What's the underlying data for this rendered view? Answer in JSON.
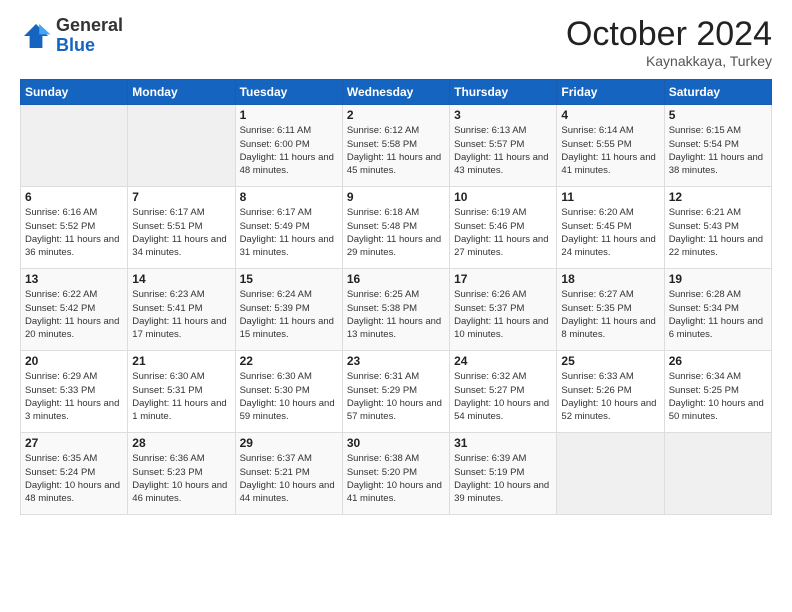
{
  "logo": {
    "general": "General",
    "blue": "Blue"
  },
  "title": "October 2024",
  "location": "Kaynakkaya, Turkey",
  "days_header": [
    "Sunday",
    "Monday",
    "Tuesday",
    "Wednesday",
    "Thursday",
    "Friday",
    "Saturday"
  ],
  "weeks": [
    [
      {
        "day": "",
        "sunrise": "",
        "sunset": "",
        "daylight": ""
      },
      {
        "day": "",
        "sunrise": "",
        "sunset": "",
        "daylight": ""
      },
      {
        "day": "1",
        "sunrise": "Sunrise: 6:11 AM",
        "sunset": "Sunset: 6:00 PM",
        "daylight": "Daylight: 11 hours and 48 minutes."
      },
      {
        "day": "2",
        "sunrise": "Sunrise: 6:12 AM",
        "sunset": "Sunset: 5:58 PM",
        "daylight": "Daylight: 11 hours and 45 minutes."
      },
      {
        "day": "3",
        "sunrise": "Sunrise: 6:13 AM",
        "sunset": "Sunset: 5:57 PM",
        "daylight": "Daylight: 11 hours and 43 minutes."
      },
      {
        "day": "4",
        "sunrise": "Sunrise: 6:14 AM",
        "sunset": "Sunset: 5:55 PM",
        "daylight": "Daylight: 11 hours and 41 minutes."
      },
      {
        "day": "5",
        "sunrise": "Sunrise: 6:15 AM",
        "sunset": "Sunset: 5:54 PM",
        "daylight": "Daylight: 11 hours and 38 minutes."
      }
    ],
    [
      {
        "day": "6",
        "sunrise": "Sunrise: 6:16 AM",
        "sunset": "Sunset: 5:52 PM",
        "daylight": "Daylight: 11 hours and 36 minutes."
      },
      {
        "day": "7",
        "sunrise": "Sunrise: 6:17 AM",
        "sunset": "Sunset: 5:51 PM",
        "daylight": "Daylight: 11 hours and 34 minutes."
      },
      {
        "day": "8",
        "sunrise": "Sunrise: 6:17 AM",
        "sunset": "Sunset: 5:49 PM",
        "daylight": "Daylight: 11 hours and 31 minutes."
      },
      {
        "day": "9",
        "sunrise": "Sunrise: 6:18 AM",
        "sunset": "Sunset: 5:48 PM",
        "daylight": "Daylight: 11 hours and 29 minutes."
      },
      {
        "day": "10",
        "sunrise": "Sunrise: 6:19 AM",
        "sunset": "Sunset: 5:46 PM",
        "daylight": "Daylight: 11 hours and 27 minutes."
      },
      {
        "day": "11",
        "sunrise": "Sunrise: 6:20 AM",
        "sunset": "Sunset: 5:45 PM",
        "daylight": "Daylight: 11 hours and 24 minutes."
      },
      {
        "day": "12",
        "sunrise": "Sunrise: 6:21 AM",
        "sunset": "Sunset: 5:43 PM",
        "daylight": "Daylight: 11 hours and 22 minutes."
      }
    ],
    [
      {
        "day": "13",
        "sunrise": "Sunrise: 6:22 AM",
        "sunset": "Sunset: 5:42 PM",
        "daylight": "Daylight: 11 hours and 20 minutes."
      },
      {
        "day": "14",
        "sunrise": "Sunrise: 6:23 AM",
        "sunset": "Sunset: 5:41 PM",
        "daylight": "Daylight: 11 hours and 17 minutes."
      },
      {
        "day": "15",
        "sunrise": "Sunrise: 6:24 AM",
        "sunset": "Sunset: 5:39 PM",
        "daylight": "Daylight: 11 hours and 15 minutes."
      },
      {
        "day": "16",
        "sunrise": "Sunrise: 6:25 AM",
        "sunset": "Sunset: 5:38 PM",
        "daylight": "Daylight: 11 hours and 13 minutes."
      },
      {
        "day": "17",
        "sunrise": "Sunrise: 6:26 AM",
        "sunset": "Sunset: 5:37 PM",
        "daylight": "Daylight: 11 hours and 10 minutes."
      },
      {
        "day": "18",
        "sunrise": "Sunrise: 6:27 AM",
        "sunset": "Sunset: 5:35 PM",
        "daylight": "Daylight: 11 hours and 8 minutes."
      },
      {
        "day": "19",
        "sunrise": "Sunrise: 6:28 AM",
        "sunset": "Sunset: 5:34 PM",
        "daylight": "Daylight: 11 hours and 6 minutes."
      }
    ],
    [
      {
        "day": "20",
        "sunrise": "Sunrise: 6:29 AM",
        "sunset": "Sunset: 5:33 PM",
        "daylight": "Daylight: 11 hours and 3 minutes."
      },
      {
        "day": "21",
        "sunrise": "Sunrise: 6:30 AM",
        "sunset": "Sunset: 5:31 PM",
        "daylight": "Daylight: 11 hours and 1 minute."
      },
      {
        "day": "22",
        "sunrise": "Sunrise: 6:30 AM",
        "sunset": "Sunset: 5:30 PM",
        "daylight": "Daylight: 10 hours and 59 minutes."
      },
      {
        "day": "23",
        "sunrise": "Sunrise: 6:31 AM",
        "sunset": "Sunset: 5:29 PM",
        "daylight": "Daylight: 10 hours and 57 minutes."
      },
      {
        "day": "24",
        "sunrise": "Sunrise: 6:32 AM",
        "sunset": "Sunset: 5:27 PM",
        "daylight": "Daylight: 10 hours and 54 minutes."
      },
      {
        "day": "25",
        "sunrise": "Sunrise: 6:33 AM",
        "sunset": "Sunset: 5:26 PM",
        "daylight": "Daylight: 10 hours and 52 minutes."
      },
      {
        "day": "26",
        "sunrise": "Sunrise: 6:34 AM",
        "sunset": "Sunset: 5:25 PM",
        "daylight": "Daylight: 10 hours and 50 minutes."
      }
    ],
    [
      {
        "day": "27",
        "sunrise": "Sunrise: 6:35 AM",
        "sunset": "Sunset: 5:24 PM",
        "daylight": "Daylight: 10 hours and 48 minutes."
      },
      {
        "day": "28",
        "sunrise": "Sunrise: 6:36 AM",
        "sunset": "Sunset: 5:23 PM",
        "daylight": "Daylight: 10 hours and 46 minutes."
      },
      {
        "day": "29",
        "sunrise": "Sunrise: 6:37 AM",
        "sunset": "Sunset: 5:21 PM",
        "daylight": "Daylight: 10 hours and 44 minutes."
      },
      {
        "day": "30",
        "sunrise": "Sunrise: 6:38 AM",
        "sunset": "Sunset: 5:20 PM",
        "daylight": "Daylight: 10 hours and 41 minutes."
      },
      {
        "day": "31",
        "sunrise": "Sunrise: 6:39 AM",
        "sunset": "Sunset: 5:19 PM",
        "daylight": "Daylight: 10 hours and 39 minutes."
      },
      {
        "day": "",
        "sunrise": "",
        "sunset": "",
        "daylight": ""
      },
      {
        "day": "",
        "sunrise": "",
        "sunset": "",
        "daylight": ""
      }
    ]
  ]
}
